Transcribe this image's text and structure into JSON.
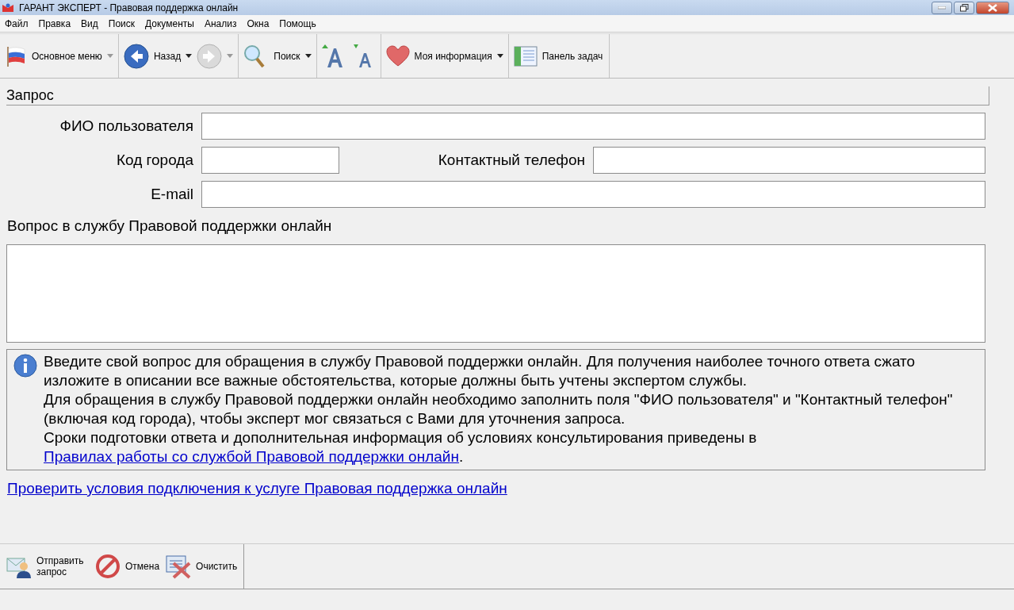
{
  "window": {
    "title": "ГАРАНТ ЭКСПЕРТ - Правовая поддержка онлайн"
  },
  "menu": [
    "Файл",
    "Правка",
    "Вид",
    "Поиск",
    "Документы",
    "Анализ",
    "Окна",
    "Помощь"
  ],
  "toolbar": {
    "main_menu": {
      "label": "Основное меню"
    },
    "back": {
      "label": "Назад"
    },
    "forward": {
      "disabled": true
    },
    "search": {
      "label": "Поиск"
    },
    "my_info": {
      "label": "Моя информация"
    },
    "task_panel": {
      "label": "Панель задач"
    }
  },
  "section": {
    "title": "Запрос"
  },
  "fields": {
    "fio": {
      "label": "ФИО пользователя"
    },
    "city_code": {
      "label": "Код города"
    },
    "phone": {
      "label": "Контактный телефон"
    },
    "email": {
      "label": "E-mail"
    }
  },
  "question": {
    "label": "Вопрос в службу Правовой поддержки онлайн"
  },
  "info": {
    "paragraphs": [
      "Введите свой вопрос для обращения в службу Правовой поддержки онлайн. Для получения наиболее точного ответа сжато изложите в описании все важные обстоятельства, которые должны быть учтены экспертом службы.",
      "Для обращения в службу Правовой поддержки онлайн необходимо заполнить поля \"ФИО пользователя\" и \"Контактный телефон\" (включая код города), чтобы эксперт мог связаться с Вами для уточнения запроса."
    ],
    "last_text": "Сроки подготовки ответа и дополнительная информация об условиях консультирования приведены в",
    "last_link": "Правилах работы со службой Правовой поддержки онлайн",
    "last_end": "."
  },
  "check_link": "Проверить условия подключения к услуге Правовая поддержка онлайн",
  "actions": {
    "send": "Отправить запрос",
    "cancel": "Отмена",
    "clear": "Очистить"
  }
}
